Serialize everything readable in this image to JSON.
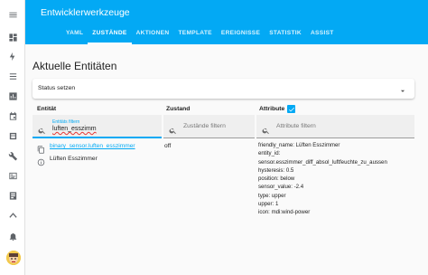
{
  "header": {
    "title": "Entwicklerwerkzeuge"
  },
  "tabs": [
    {
      "label": "YAML",
      "active": false
    },
    {
      "label": "ZUSTÄNDE",
      "active": true
    },
    {
      "label": "AKTIONEN",
      "active": false
    },
    {
      "label": "TEMPLATE",
      "active": false
    },
    {
      "label": "EREIGNISSE",
      "active": false
    },
    {
      "label": "STATISTIK",
      "active": false
    },
    {
      "label": "ASSIST",
      "active": false
    }
  ],
  "sidebar": {
    "icons": [
      "menu-icon",
      "dashboard-icon",
      "energy-icon",
      "logbook-icon",
      "history-icon",
      "calendar-icon",
      "media-icon",
      "developer-tools-icon",
      "todo-icon",
      "config-icon",
      "hacs-icon",
      "notifications-icon",
      "user-avatar"
    ]
  },
  "main": {
    "title": "Aktuelle Entitäten",
    "status_section": {
      "label": "Status setzen"
    },
    "columns": {
      "entity": "Entität",
      "state": "Zustand",
      "attributes": "Attribute"
    },
    "attributes_checked": true,
    "filters": {
      "entity": {
        "label": "Entitäts filtern",
        "value": "luften_esszimm"
      },
      "state": {
        "placeholder": "Zustände filtern"
      },
      "attributes": {
        "placeholder": "Attribute filtern"
      }
    },
    "rows": [
      {
        "entity_id": "binary_sensor.luften_esszimmer",
        "friendly_name": "Lüften Esszimmer",
        "state": "off",
        "attributes": [
          "friendly_name: Lüften Esszimmer",
          "entity_id:",
          "sensor.esszimmer_diff_absol_luftfeuchte_zu_aussen",
          "hysteresis: 0.5",
          "position: below",
          "sensor_value: -2.4",
          "type: upper",
          "upper: 1",
          "icon: mdi:wind-power"
        ]
      }
    ]
  },
  "colors": {
    "accent": "#03a9f4",
    "link": "#03a9f4"
  }
}
